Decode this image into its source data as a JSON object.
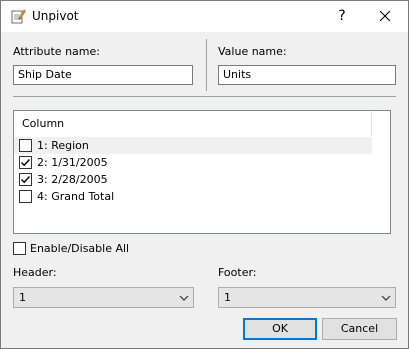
{
  "window": {
    "title": "Unpivot",
    "help": "?"
  },
  "attribute": {
    "label": "Attribute name:",
    "value": "Ship Date"
  },
  "value_field": {
    "label": "Value name:",
    "value": "Units"
  },
  "columns": {
    "header": "Column",
    "items": [
      {
        "label": "1: Region",
        "checked": false,
        "selected": true
      },
      {
        "label": "2: 1/31/2005",
        "checked": true,
        "selected": false
      },
      {
        "label": "3: 2/28/2005",
        "checked": true,
        "selected": false
      },
      {
        "label": "4: Grand Total",
        "checked": false,
        "selected": false
      }
    ]
  },
  "enable_all": {
    "label": "Enable/Disable All",
    "checked": false
  },
  "header_select": {
    "label": "Header:",
    "value": "1"
  },
  "footer_select": {
    "label": "Footer:",
    "value": "1"
  },
  "buttons": {
    "ok": "OK",
    "cancel": "Cancel"
  },
  "icons": {
    "app": "notepad-pencil-icon",
    "close": "close-icon",
    "dropdown": "chevron-down-icon",
    "check": "checkmark-icon"
  },
  "colors": {
    "accent": "#0078d7",
    "dialog_bg": "#f0f0f0",
    "combo_bg": "#e5e5e5"
  }
}
